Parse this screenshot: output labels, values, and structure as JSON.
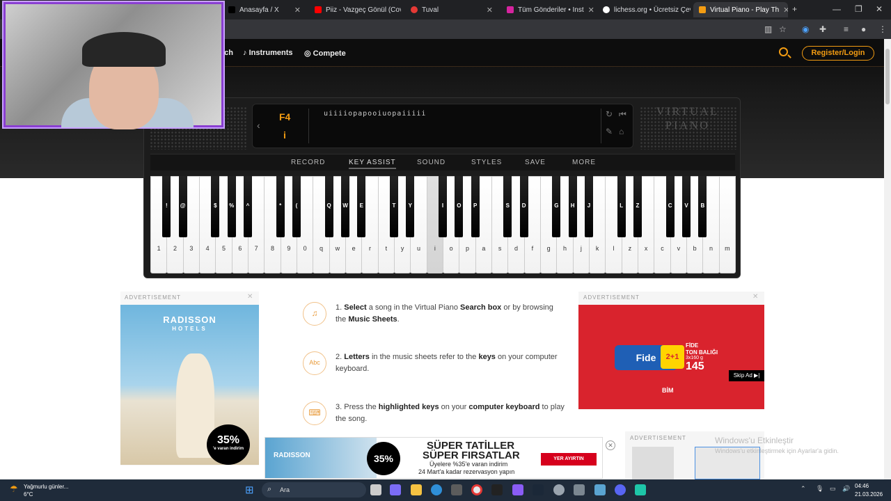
{
  "browser": {
    "tabs": [
      {
        "title": "Anasayfa / X",
        "color": "#000000"
      },
      {
        "title": "Piiz - Vazgeç Gönül (Cove",
        "color": "#ff0000"
      },
      {
        "title": "Tuval",
        "color": "#e53935"
      },
      {
        "title": "Tüm Gönderiler • Inst",
        "color": "#d6249f"
      },
      {
        "title": "lichess.org • Ücretsiz Çev",
        "color": "#ffffff"
      },
      {
        "title": "Virtual Piano - Play Th",
        "color": "#f39c12"
      }
    ]
  },
  "nav": {
    "items": [
      "ach",
      "Instruments",
      "Compete"
    ],
    "register_label": "Register/Login"
  },
  "piano": {
    "current_note": "F4",
    "current_key": "i",
    "sequence": "uiiiiopapooiuopaiiiii",
    "logo": "VIRTUAL PIANO",
    "menu": [
      "RECORD",
      "KEY ASSIST",
      "SOUND",
      "STYLES",
      "SAVE",
      "MORE"
    ],
    "white_keys": [
      "1",
      "2",
      "3",
      "4",
      "5",
      "6",
      "7",
      "8",
      "9",
      "0",
      "q",
      "w",
      "e",
      "r",
      "t",
      "y",
      "u",
      "i",
      "o",
      "p",
      "a",
      "s",
      "d",
      "f",
      "g",
      "h",
      "j",
      "k",
      "l",
      "z",
      "x",
      "c",
      "v",
      "b",
      "n",
      "m"
    ],
    "black_keys": [
      "!",
      "@",
      "$",
      "%",
      "^",
      "*",
      "(",
      "Q",
      "W",
      "E",
      "T",
      "Y",
      "I",
      "O",
      "P",
      "S",
      "D",
      "G",
      "H",
      "J",
      "L",
      "Z",
      "C",
      "V",
      "B"
    ],
    "pressed_key": "i"
  },
  "ads": {
    "label": "ADVERTISEMENT",
    "left_brand": "RADISSON",
    "left_brand_sub": "HOTELS",
    "left_badge": "35%",
    "left_badge_sub": "'e varan indirim",
    "right_brand": "FİDE",
    "right_product": "TON BALIĞI",
    "right_size": "3x160 g",
    "right_price": "145",
    "right_deal": "2+1",
    "right_skip": "Skip Ad ▶|",
    "right_store": "BİM",
    "bottom_title": "SÜPER TATİLLER",
    "bottom_title2": "SÜPER FIRSATLAR",
    "bottom_sub": "Üyelere %35'e varan indirim",
    "bottom_sub2": "24 Mart'a kadar rezervasyon yapın",
    "bottom_cta": "YER AYIRTIN",
    "bottom_badge": "35%"
  },
  "steps": [
    {
      "icon": "♫",
      "html_parts": [
        "1. ",
        "Select",
        " a song in the Virtual Piano ",
        "Search box",
        " or by browsing the ",
        "Music Sheets",
        "."
      ]
    },
    {
      "icon": "Abc",
      "html_parts": [
        "2. ",
        "Letters",
        " in the music sheets refer to the ",
        "keys",
        " on your computer keyboard.",
        "",
        ""
      ]
    },
    {
      "icon": "⌨",
      "html_parts": [
        "3. Press the ",
        "highlighted keys",
        " on your ",
        "computer keyboard",
        " to play the song.",
        "",
        ""
      ]
    }
  ],
  "watermark": {
    "title": "Windows'u Etkinleştir",
    "sub": "Windows'u etkinleştirmek için Ayarlar'a gidin."
  },
  "taskbar": {
    "weather": "Yağmurlu günler...",
    "temp": "6°C",
    "search": "Ara",
    "time": "04:46",
    "date": "21.03.2026"
  }
}
